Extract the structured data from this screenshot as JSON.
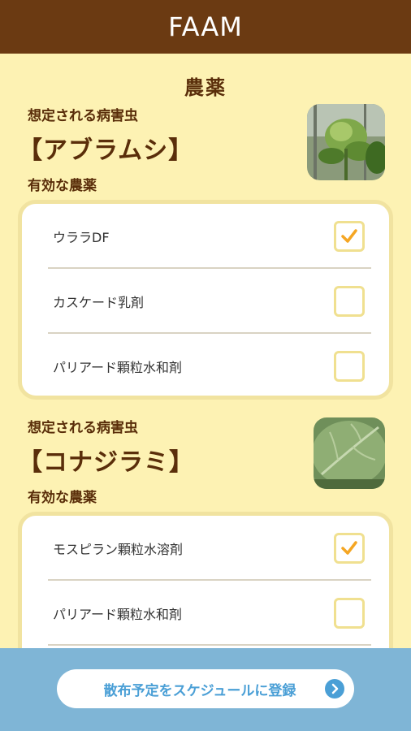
{
  "header": {
    "app_title": "FAAM"
  },
  "page": {
    "title": "農薬"
  },
  "sections": [
    {
      "caption": "想定される病害虫",
      "pest_name": "【アブラムシ】",
      "effective_label": "有効な農薬",
      "pesticides": [
        {
          "label": "ウララDF",
          "checked": true
        },
        {
          "label": "カスケード乳剤",
          "checked": false
        },
        {
          "label": "パリアード顆粒水和剤",
          "checked": false
        }
      ]
    },
    {
      "caption": "想定される病害虫",
      "pest_name": "【コナジラミ】",
      "effective_label": "有効な農薬",
      "pesticides": [
        {
          "label": "モスピラン顆粒水溶剤",
          "checked": true
        },
        {
          "label": "パリアード顆粒水和剤",
          "checked": false
        }
      ]
    }
  ],
  "footer": {
    "schedule_button_label": "散布予定をスケジュールに登録"
  },
  "colors": {
    "header_bg": "#6b3a12",
    "page_bg": "#fdf2b3",
    "accent_check": "#f5a623",
    "footer_bg": "#7fb5d6",
    "button_text": "#4a9fd6"
  }
}
